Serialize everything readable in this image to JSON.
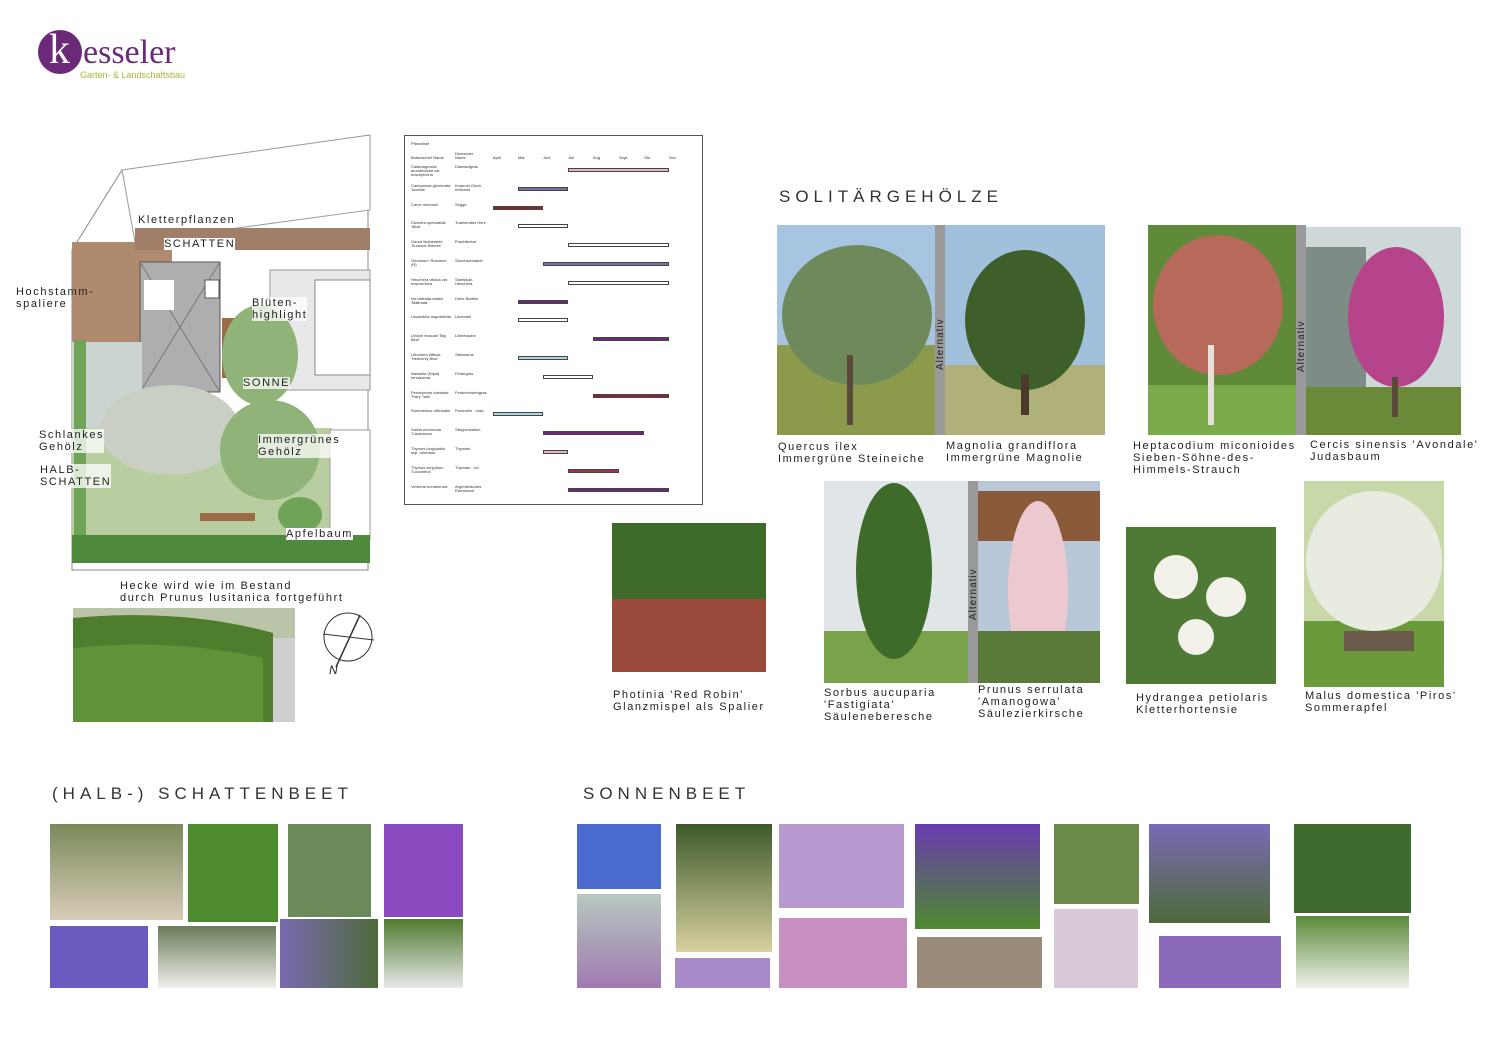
{
  "logo": {
    "initial": "k",
    "word": "esseler",
    "sub": "Garten- & Landschaftsbau"
  },
  "plan": {
    "labels": [
      "Kletterpflanzen",
      "SCHATTEN",
      "Hochstamm-\nspaliere",
      "Blüten-\nhighlight",
      "SONNE",
      "Schlankes\nGehölz",
      "Immergrünes\nGehölz",
      "HALB-\nSCHATTEN",
      "Apfelbaum"
    ],
    "hedge_caption": "Hecke wird wie im Bestand\ndurch Prunus lusitanica fortgeführt",
    "north": "N"
  },
  "bloom_table": {
    "title": "Pflanzliste",
    "headers": [
      "Botanischer Name",
      "Deutscher Name",
      "April",
      "Mai",
      "Juni",
      "Juli",
      "Aug",
      "Sept",
      "Okt",
      "Nov"
    ],
    "rows": [
      {
        "bot": "Calamagrostis arundinacea var. brachytricha",
        "de": "Diamantgras",
        "start": 3,
        "end": 7,
        "color": "#e8b4c4"
      },
      {
        "bot": "Campanula glomerata 'Acaulis'",
        "de": "Knaeuel-Glock enblume",
        "start": 1,
        "end": 3,
        "color": "#7b6fa8"
      },
      {
        "bot": "Carex morrowii",
        "de": "Segge",
        "start": 0,
        "end": 2,
        "color": "#8a2633"
      },
      {
        "bot": "Dicentra spectabilis 'Alba'",
        "de": "Traenendes Herz",
        "start": 1,
        "end": 3,
        "color": "#ffffff"
      },
      {
        "bot": "Gaura lindheimeri 'Summer Breeze'",
        "de": "Prachtkerze",
        "start": 3,
        "end": 7,
        "color": "#ffffff"
      },
      {
        "bot": "Geranium 'Rozanne' (R)",
        "de": "Storchschnabel",
        "start": 2,
        "end": 7,
        "color": "#7b6fa8"
      },
      {
        "bot": "Heuchera villosa var. macrorrhiza",
        "de": "Samtlaub-Heuchera",
        "start": 3,
        "end": 7,
        "color": "#ffffff"
      },
      {
        "bot": "Iris barbata-elatior 'Matinata'",
        "de": "Hohe Bartiris",
        "start": 1,
        "end": 3,
        "color": "#6b2a77"
      },
      {
        "bot": "Lavandula angustifolia",
        "de": "Lavendel",
        "start": 1,
        "end": 3,
        "color": "#ffffff"
      },
      {
        "bot": "Liriope muscari 'Big Blue'",
        "de": "Lilientraube",
        "start": 4,
        "end": 7,
        "color": "#6b2a77"
      },
      {
        "bot": "Lithodora diffusa 'Heavenly Blue'",
        "de": "Steinsame",
        "start": 1,
        "end": 3,
        "color": "#a8d8e0"
      },
      {
        "bot": "Nassella (Stipa) tenuissima",
        "de": "Federgras",
        "start": 2,
        "end": 4,
        "color": "#ffffff"
      },
      {
        "bot": "Pennisetum orientale 'Fairy Tails'",
        "de": "Federborstengras",
        "start": 4,
        "end": 7,
        "color": "#8a2633"
      },
      {
        "bot": "Rosmarinus officinalis",
        "de": "Rosmarin - rosa",
        "start": 0,
        "end": 2,
        "color": "#a8d8e0"
      },
      {
        "bot": "Salvia nemorosa 'Caradonna'",
        "de": "Steppensalbei",
        "start": 2,
        "end": 6,
        "color": "#6b2a77"
      },
      {
        "bot": "Thymus longicaulis ssp. odoratus",
        "de": "Thymian",
        "start": 2,
        "end": 3,
        "color": "#e8b4c4"
      },
      {
        "bot": "Thymus serpyllum 'Coccineus'",
        "de": "Thymian - rot",
        "start": 3,
        "end": 5,
        "color": "#a8304a"
      },
      {
        "bot": "Verbena bonariensis",
        "de": "Argentinisches Eisenkraut",
        "start": 3,
        "end": 7,
        "color": "#6b2a77"
      }
    ]
  },
  "sections": {
    "solitaer": "SOLITÄRGEHÖLZE",
    "schattenbeet": "(HALB-) SCHATTENBEET",
    "sonnenbeet": "SONNENBEET",
    "alternativ": "Alternativ"
  },
  "captions": {
    "quercus": "Quercus ilex\nImmergrüne Steineiche",
    "magnolia": "Magnolia grandiflora\nImmergrüne Magnolie",
    "heptacodium": "Heptacodium miconioides\nSieben-Söhne-des-\nHimmels-Strauch",
    "cercis": "Cercis sinensis 'Avondale'\nJudasbaum",
    "photinia": "Photinia 'Red Robin'\nGlanzmispel als Spalier",
    "sorbus": "Sorbus aucuparia\n'Fastigiata'\nSäuleneberesche",
    "prunus": "Prunus serrulata\n'Amanogowa'\nSäulezierkirsche",
    "hydrangea": "Hydrangea petiolaris\nKletterhortensie",
    "malus": "Malus domestica 'Piros'\nSommerapfel"
  },
  "colors": {
    "brand": "#6b2a77",
    "brand_green": "#a9b43a"
  }
}
